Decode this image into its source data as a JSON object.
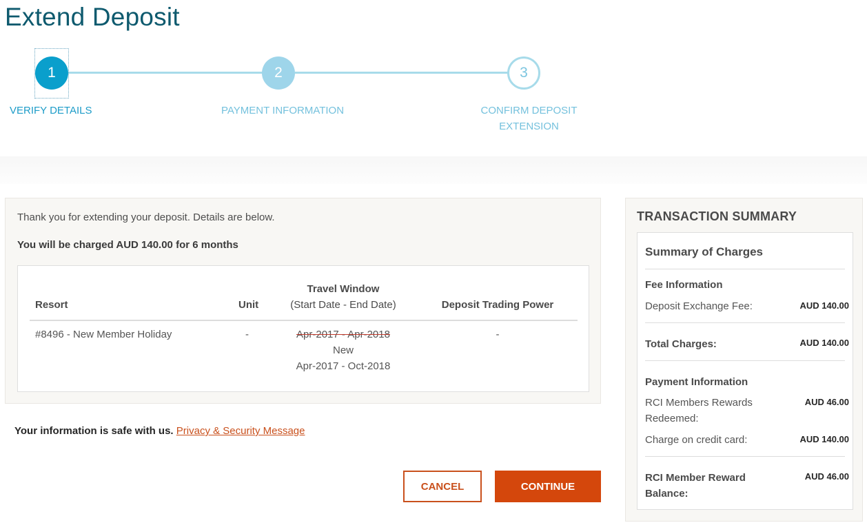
{
  "page": {
    "title": "Extend Deposit"
  },
  "stepper": {
    "steps": [
      {
        "number": "1",
        "label": "VERIFY DETAILS",
        "state": "active"
      },
      {
        "number": "2",
        "label": "PAYMENT INFORMATION",
        "state": "upcoming"
      },
      {
        "number": "3",
        "label_line1": "CONFIRM DEPOSIT",
        "label_line2": "EXTENSION",
        "state": "upcoming"
      }
    ]
  },
  "details": {
    "intro": "Thank you for extending your deposit. Details are below.",
    "charge_summary": "You will be charged AUD 140.00 for 6 months",
    "table": {
      "headers": {
        "resort": "Resort",
        "unit": "Unit",
        "travel_window": "Travel Window",
        "travel_window_sub": "(Start Date - End Date)",
        "trading_power": "Deposit Trading Power"
      },
      "rows": [
        {
          "resort": "#8496 - New Member Holiday",
          "unit": "-",
          "old_window": "Apr-2017 - Apr-2018",
          "new_label": "New",
          "new_window": "Apr-2017 - Oct-2018",
          "trading_power": "-"
        }
      ]
    }
  },
  "security": {
    "text": "Your information is safe with us.",
    "link": "Privacy & Security Message"
  },
  "actions": {
    "cancel": "CANCEL",
    "continue": "CONTINUE"
  },
  "summary": {
    "title": "TRANSACTION SUMMARY",
    "heading": "Summary of Charges",
    "fee_section": "Fee Information",
    "fee_label": "Deposit Exchange Fee:",
    "fee_value": "AUD 140.00",
    "total_label": "Total Charges:",
    "total_value": "AUD 140.00",
    "payment_section": "Payment Information",
    "rewards_label": "RCI Members Rewards Redeemed:",
    "rewards_value": "AUD 46.00",
    "card_label": "Charge on credit card:",
    "card_value": "AUD 140.00",
    "balance_label": "RCI Member Reward Balance:",
    "balance_value": "AUD 46.00"
  },
  "colors": {
    "title": "#0e5a6e",
    "step_active": "#0a9fcc",
    "step_upcoming": "#9ed5ea",
    "accent_orange": "#d4470c",
    "panel_bg": "#f8f7f4"
  }
}
